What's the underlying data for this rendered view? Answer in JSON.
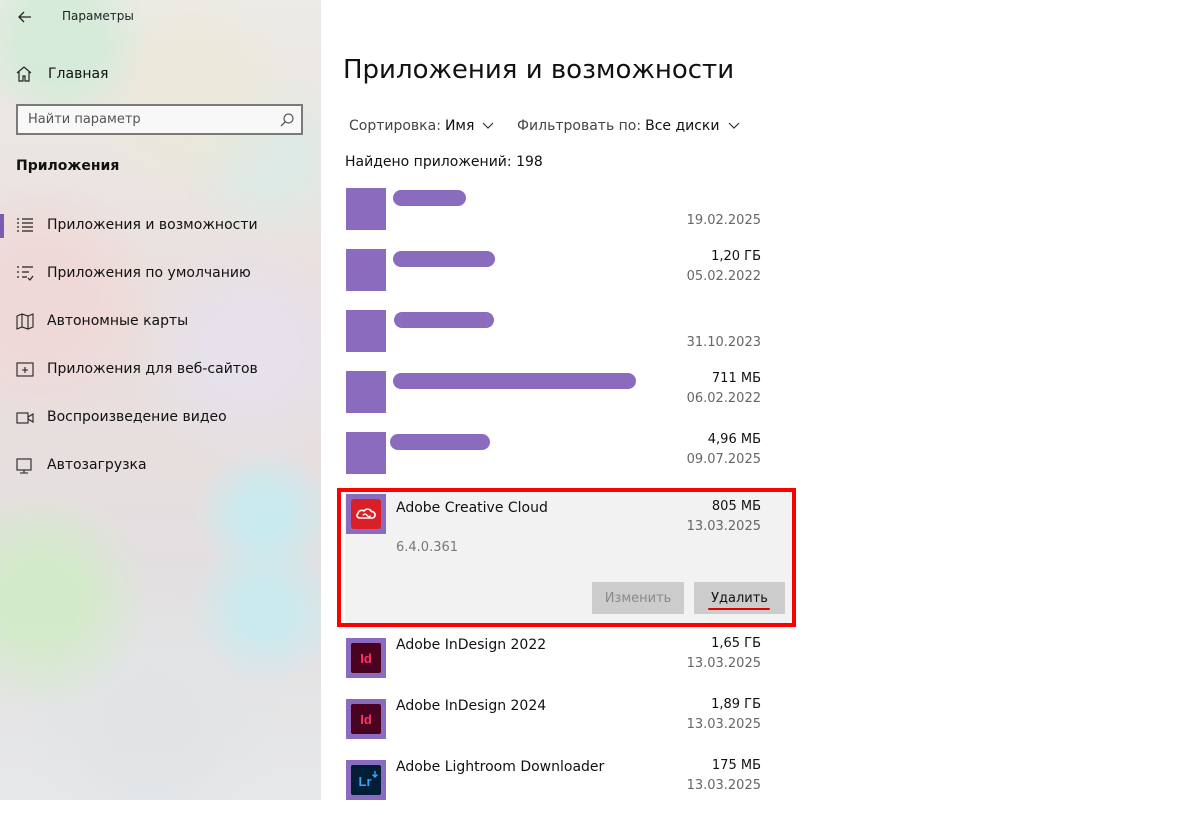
{
  "window": {
    "title": "Параметры"
  },
  "sidebar": {
    "home_label": "Главная",
    "search_placeholder": "Найти параметр",
    "section_title": "Приложения",
    "items": [
      {
        "label": "Приложения и возможности",
        "icon": "apps-features-icon",
        "selected": true
      },
      {
        "label": "Приложения по умолчанию",
        "icon": "default-apps-icon",
        "selected": false
      },
      {
        "label": "Автономные карты",
        "icon": "offline-maps-icon",
        "selected": false
      },
      {
        "label": "Приложения для веб-сайтов",
        "icon": "apps-for-websites-icon",
        "selected": false
      },
      {
        "label": "Воспроизведение видео",
        "icon": "video-playback-icon",
        "selected": false
      },
      {
        "label": "Автозагрузка",
        "icon": "startup-icon",
        "selected": false
      }
    ]
  },
  "main": {
    "title": "Приложения и возможности",
    "sort_label": "Сортировка:",
    "sort_value": "Имя",
    "filter_label": "Фильтровать по:",
    "filter_value": "Все диски",
    "found_count": "Найдено приложений: 198",
    "apps": [
      {
        "name": "",
        "size": "",
        "date": "19.02.2025",
        "redacted": true
      },
      {
        "name": "",
        "size": "1,20 ГБ",
        "date": "05.02.2022",
        "redacted": true
      },
      {
        "name": "",
        "size": "",
        "date": "31.10.2023",
        "redacted": true
      },
      {
        "name": "",
        "size": "711 МБ",
        "date": "06.02.2022",
        "redacted": true
      },
      {
        "name": "",
        "size": "4,96 МБ",
        "date": "09.07.2025",
        "redacted": true
      },
      {
        "name": "Adobe Creative Cloud",
        "size": "805 МБ",
        "date": "13.03.2025",
        "version": "6.4.0.361",
        "selected": true,
        "icon": "adobe-creative-cloud-icon"
      },
      {
        "name": "Adobe InDesign 2022",
        "size": "1,65 ГБ",
        "date": "13.03.2025",
        "icon": "adobe-indesign-icon",
        "icon_text": "Id"
      },
      {
        "name": "Adobe InDesign 2024",
        "size": "1,89 ГБ",
        "date": "13.03.2025",
        "icon": "adobe-indesign-icon",
        "icon_text": "Id"
      },
      {
        "name": "Adobe Lightroom Downloader",
        "size": "175 МБ",
        "date": "13.03.2025",
        "icon": "adobe-lightroom-icon",
        "icon_text": "Lr"
      }
    ],
    "buttons": {
      "modify": "Изменить",
      "uninstall": "Удалить"
    }
  },
  "colors": {
    "accent": "#7a5bb3",
    "redaction": "#8a6bbd",
    "highlight": "#ff0000",
    "indesign_bg": "#49021f",
    "indesign_text": "#ff3366",
    "lightroom_bg": "#001e36",
    "lightroom_text": "#31a8ff",
    "creative_cloud": "#da1f26"
  }
}
